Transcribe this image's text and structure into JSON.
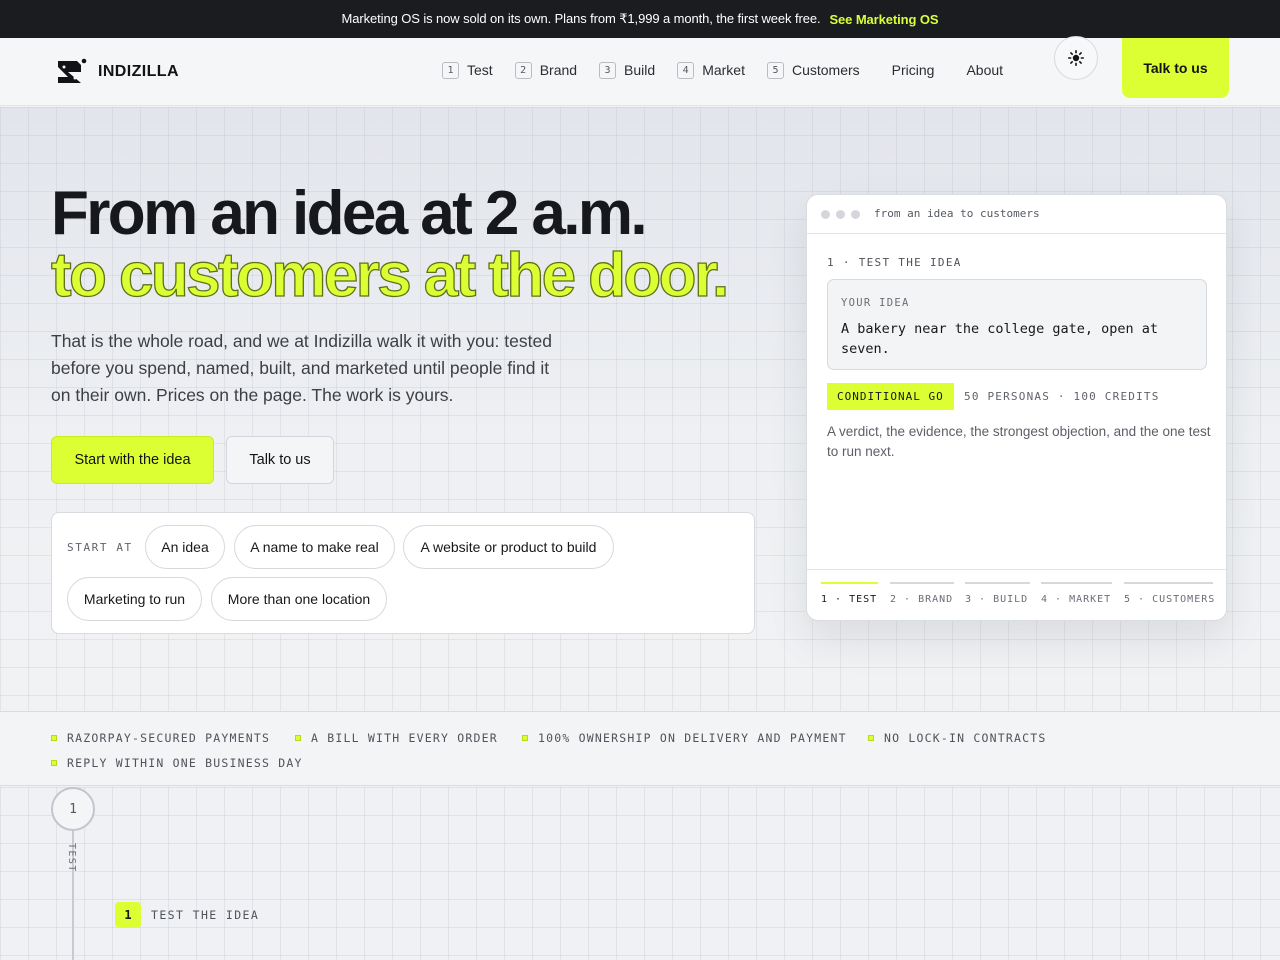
{
  "announcement": {
    "text": "Marketing OS is now sold on its own. Plans from ₹1,999 a month, the first week free.",
    "link": "See Marketing OS"
  },
  "header": {
    "brand": "INDIZILLA",
    "nav_steps": [
      {
        "num": "1",
        "label": "Test"
      },
      {
        "num": "2",
        "label": "Brand"
      },
      {
        "num": "3",
        "label": "Build"
      },
      {
        "num": "4",
        "label": "Market"
      },
      {
        "num": "5",
        "label": "Customers"
      }
    ],
    "nav_links": [
      "Pricing",
      "About"
    ],
    "theme_icon": "sun-icon",
    "cta": "Talk to us"
  },
  "hero": {
    "title_line1": "From an idea at 2 a.m.",
    "title_line2": "to customers at the door.",
    "lede": "That is the whole road, and we at Indizilla walk it with you: tested before you spend, named, built, and marketed until people find it on their own. Prices on the page. The work is yours.",
    "primary_cta": "Start with the idea",
    "secondary_cta": "Talk to us",
    "start_at": {
      "label": "START AT",
      "options": [
        "An idea",
        "A name to make real",
        "A website or product to build",
        "Marketing to run",
        "More than one location"
      ]
    }
  },
  "card": {
    "title": "from an idea to customers",
    "step_label": "1 · TEST THE IDEA",
    "idea_label": "YOUR IDEA",
    "idea_text": "A bakery near the college gate, open at seven.",
    "verdict": "CONDITIONAL GO",
    "verdict_meta": "50 PERSONAS · 100 CREDITS",
    "description": "A verdict, the evidence, the strongest objection, and the one test to run next.",
    "tabs": [
      "1 · TEST",
      "2 · BRAND",
      "3 · BUILD",
      "4 · MARKET",
      "5 · CUSTOMERS"
    ],
    "active_tab": 0
  },
  "trust": {
    "items": [
      "RAZORPAY-SECURED PAYMENTS",
      "A BILL WITH EVERY ORDER",
      "100% OWNERSHIP ON DELIVERY AND PAYMENT",
      "NO LOCK-IN CONTRACTS",
      "REPLY WITHIN ONE BUSINESS DAY"
    ]
  },
  "process": {
    "step_number": "1",
    "step_name": "TEST",
    "sub_number": "1",
    "sub_label": "TEST THE IDEA"
  },
  "colors": {
    "accent": "#dcff33",
    "dark": "#1b1c20",
    "background": "#eff1f4"
  }
}
